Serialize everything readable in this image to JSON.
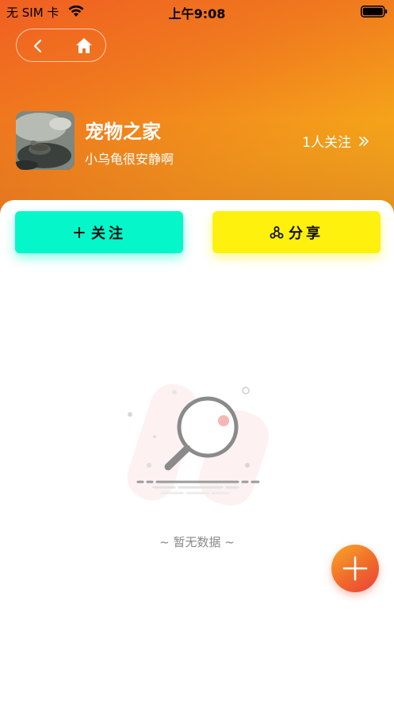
{
  "status_bar": {
    "carrier": "无 SIM 卡",
    "time": "上午9:08"
  },
  "nav": {
    "back_icon": "chevron-left-icon",
    "home_icon": "home-icon"
  },
  "group": {
    "name": "宠物之家",
    "description": "小乌龟很安静啊",
    "followers": "1人关注"
  },
  "actions": {
    "follow_label": "关注",
    "share_label": "分享"
  },
  "empty_state": {
    "text": "~ 暂无数据 ~"
  },
  "colors": {
    "follow": "#05f7c9",
    "share": "#fef10e",
    "header_start": "#f05f22",
    "header_end": "#f2b91c"
  }
}
